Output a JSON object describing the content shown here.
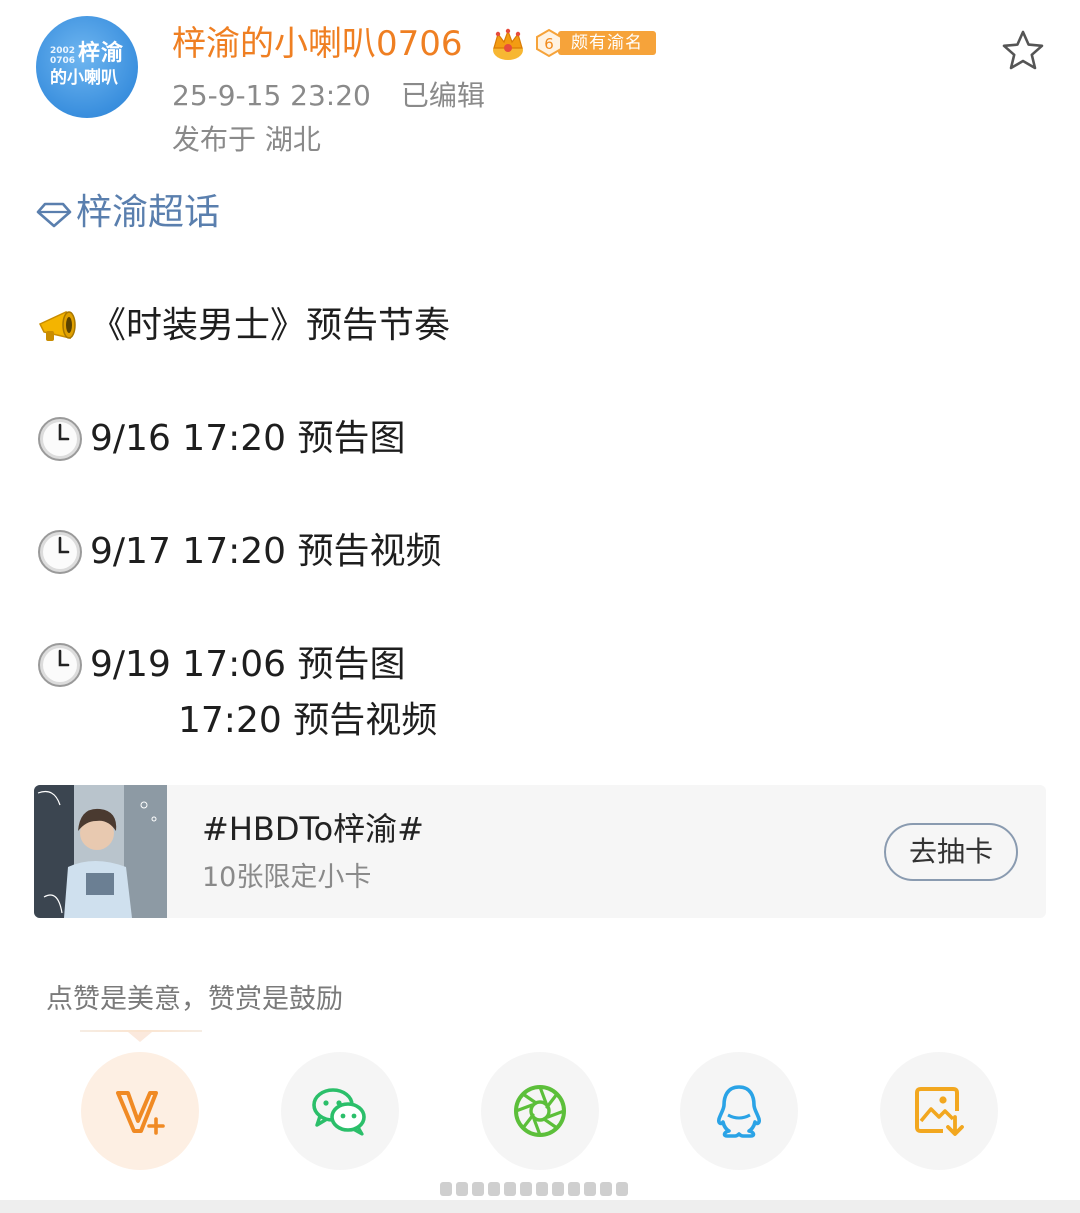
{
  "post": {
    "author": {
      "avatar_text_small": "2002\n0706",
      "avatar_text_line1": "梓渝",
      "avatar_text_line2": "的小喇叭",
      "name": "梓渝的小喇叭0706",
      "fan_level": "6",
      "fan_badge": "颇有渝名"
    },
    "timestamp": "25-9-15 23:20",
    "edited_label": "已编辑",
    "location": "发布于 湖北",
    "supertopic": "梓渝超话",
    "headline": "《时装男士》预告节奏",
    "schedule": [
      {
        "text": "9/16 17:20 预告图"
      },
      {
        "text": "9/17 17:20 预告视频"
      },
      {
        "text": "9/19 17:06 预告图"
      }
    ],
    "schedule_extra": "17:20 预告视频"
  },
  "card": {
    "title": "#HBDTo梓渝#",
    "subtitle": "10张限定小卡",
    "button": "去抽卡"
  },
  "tip": "点赞是美意，赞赏是鼓励",
  "share_buttons": [
    {
      "icon": "vplus-icon"
    },
    {
      "icon": "wechat-icon"
    },
    {
      "icon": "moments-icon"
    },
    {
      "icon": "qq-icon"
    },
    {
      "icon": "save-image-icon"
    }
  ],
  "colors": {
    "username": "#ef7f22",
    "topic": "#5a7fae",
    "badge": "#f6a33a",
    "meta": "#8a8a8a"
  }
}
